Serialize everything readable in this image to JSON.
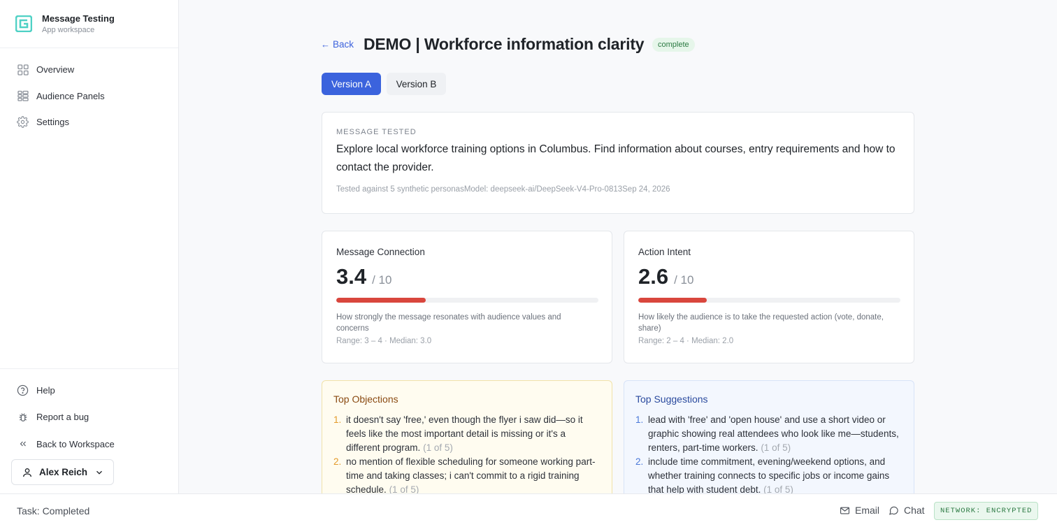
{
  "sidebar": {
    "app_title": "Message Testing",
    "app_subtitle": "App workspace",
    "nav": [
      {
        "label": "Overview",
        "icon": "grid-icon"
      },
      {
        "label": "Audience Panels",
        "icon": "panels-icon"
      },
      {
        "label": "Settings",
        "icon": "gear-icon"
      }
    ],
    "bottom": [
      {
        "label": "Help",
        "icon": "help-icon"
      },
      {
        "label": "Report a bug",
        "icon": "bug-icon"
      },
      {
        "label": "Back to Workspace",
        "icon": "double-chevron-left-icon"
      }
    ],
    "user": "Alex Reich"
  },
  "header": {
    "back_label": "Back",
    "title": "DEMO | Workforce information clarity",
    "status": "complete"
  },
  "tabs": [
    {
      "label": "Version A",
      "active": true
    },
    {
      "label": "Version B",
      "active": false
    }
  ],
  "message": {
    "eyebrow": "MESSAGE TESTED",
    "text": "Explore local workforce training options in Columbus. Find information about courses, entry requirements and how to contact the provider.",
    "meta": "Tested against 5 synthetic personasModel: deepseek-ai/DeepSeek-V4-Pro-0813Sep 24, 2026"
  },
  "metrics": [
    {
      "title": "Message Connection",
      "score": "3.4",
      "max": "/ 10",
      "fill_fraction": 0.34,
      "description": "How strongly the message resonates with audience values and concerns",
      "range": "Range: 3 – 4 · Median: 3.0"
    },
    {
      "title": "Action Intent",
      "score": "2.6",
      "max": "/ 10",
      "fill_fraction": 0.26,
      "description": "How likely the audience is to take the requested action (vote, donate, share)",
      "range": "Range: 2 – 4 · Median: 2.0"
    }
  ],
  "objections": {
    "title": "Top Objections",
    "items": [
      {
        "num": "1.",
        "text": "it doesn't say 'free,' even though the flyer i saw did—so it feels like the most important detail is missing or it's a different program.",
        "count": "(1 of 5)"
      },
      {
        "num": "2.",
        "text": "no mention of flexible scheduling for someone working part-time and taking classes; i can't commit to a rigid training schedule.",
        "count": "(1 of 5)"
      }
    ]
  },
  "suggestions": {
    "title": "Top Suggestions",
    "items": [
      {
        "num": "1.",
        "text": "lead with 'free' and 'open house' and use a short video or graphic showing real attendees who look like me—students, renters, part-time workers.",
        "count": "(1 of 5)"
      },
      {
        "num": "2.",
        "text": "include time commitment, evening/weekend options, and whether training connects to specific jobs or income gains that help with student debt.",
        "count": "(1 of 5)"
      }
    ]
  },
  "statusbar": {
    "task": "Task: Completed",
    "email": "Email",
    "chat": "Chat",
    "network": "NETWORK: ENCRYPTED"
  },
  "colors": {
    "accent": "#3b63dd",
    "bar_fill": "#d9463d",
    "badge_green": "#2c7a43",
    "brand_teal": "#4fd1c5"
  }
}
